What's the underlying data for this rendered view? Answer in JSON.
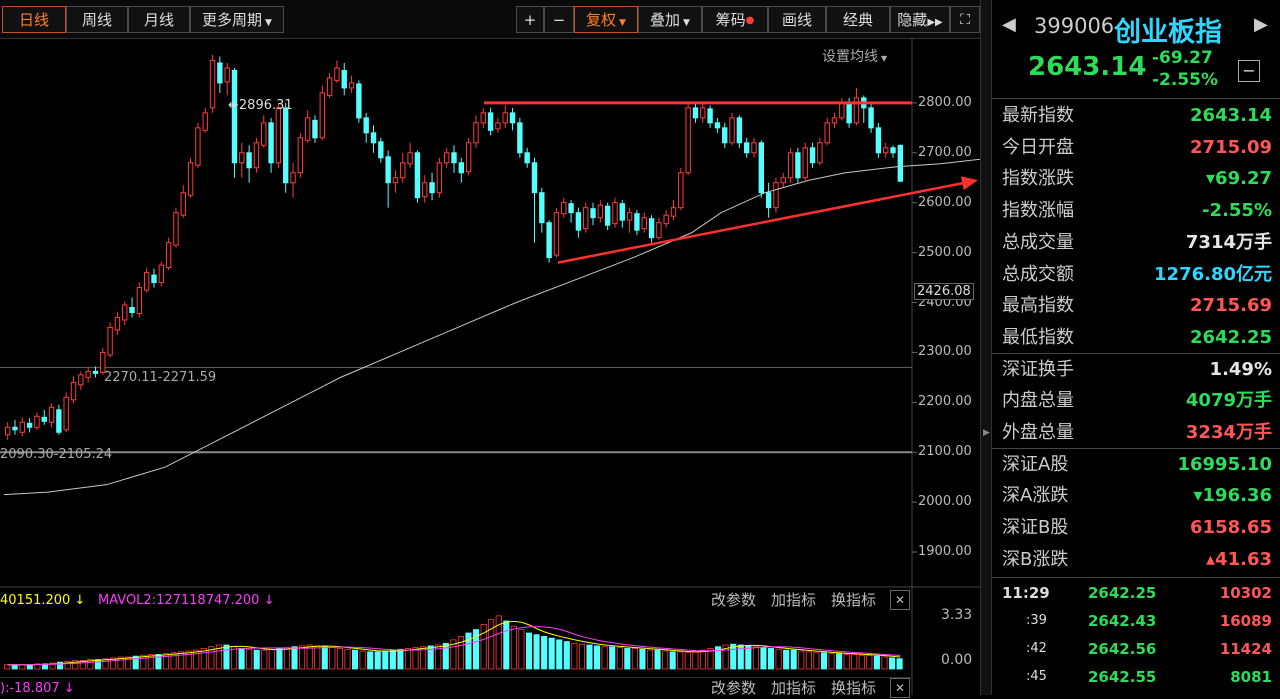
{
  "toolbar": {
    "periods": [
      "日线",
      "周线",
      "月线",
      "更多周期"
    ],
    "plus": "+",
    "minus": "−",
    "fuquan": "复权",
    "diejia": "叠加",
    "chouma": "筹码",
    "huaxian": "画线",
    "jingdian": "经典",
    "yincang": "隐藏",
    "set_ma": "设置均线"
  },
  "price_axis": {
    "labels": [
      "2800.00",
      "2700.00",
      "2600.00",
      "2500.00",
      "2400.00",
      "2300.00",
      "2200.00",
      "2100.00",
      "2000.00",
      "1900.00"
    ],
    "current": "2426.08"
  },
  "annotations": {
    "high": "2896.31",
    "mid": "2270.11-2271.59",
    "low": "2090.30-2105.24"
  },
  "volume_panel": {
    "legend1": "40151.200 ↓",
    "legend2": "MAVOL2:127118747.200 ↓",
    "btn_params": "改参数",
    "btn_add": "加指标",
    "btn_switch": "换指标",
    "close": "✕",
    "axis_top": "3.33",
    "axis_bottom": "0.00"
  },
  "macd_panel": {
    "legend": "):-18.807 ↓",
    "btn_params": "改参数",
    "btn_add": "加指标",
    "btn_switch": "换指标",
    "close": "✕"
  },
  "quote": {
    "code": "399006",
    "name": "创业板指",
    "price": "2643.14",
    "change": "-69.27",
    "change_pct": "-2.55%"
  },
  "stats": [
    {
      "label": "最新指数",
      "value": "2643.14",
      "color": "#2edc5a"
    },
    {
      "label": "今日开盘",
      "value": "2715.09",
      "color": "#ff5757"
    },
    {
      "label": "指数涨跌",
      "value": "▾69.27",
      "color": "#2edc5a"
    },
    {
      "label": "指数涨幅",
      "value": "-2.55%",
      "color": "#2edc5a"
    },
    {
      "label": "总成交量",
      "value": "7314万手",
      "color": "#e6e6e6"
    },
    {
      "label": "总成交额",
      "value": "1276.80亿元",
      "color": "#2fd7ff"
    },
    {
      "label": "最高指数",
      "value": "2715.69",
      "color": "#ff5757"
    },
    {
      "label": "最低指数",
      "value": "2642.25",
      "color": "#2edc5a"
    },
    {
      "label": "深证换手",
      "value": "1.49%",
      "color": "#e6e6e6"
    },
    {
      "label": "内盘总量",
      "value": "4079万手",
      "color": "#2edc5a"
    },
    {
      "label": "外盘总量",
      "value": "3234万手",
      "color": "#ff5757"
    },
    {
      "label": "深证A股",
      "value": "16995.10",
      "color": "#2edc5a"
    },
    {
      "label": "深A涨跌",
      "value": "▾196.36",
      "color": "#2edc5a"
    },
    {
      "label": "深证B股",
      "value": "6158.65",
      "color": "#ff5757"
    },
    {
      "label": "深B涨跌",
      "value": "▴41.63",
      "color": "#ff5757"
    }
  ],
  "ticks": [
    {
      "time": "11:29",
      "price": "2642.25",
      "vol": "10302"
    },
    {
      "time": ":39",
      "price": "2642.43",
      "vol": "16089"
    },
    {
      "time": ":42",
      "price": "2642.56",
      "vol": "11424"
    },
    {
      "time": ":45",
      "price": "2642.55",
      "vol": "8081"
    }
  ],
  "chart_data": {
    "type": "candlestick",
    "ylim": [
      1840,
      2930
    ],
    "price_ticks": [
      2800,
      2700,
      2600,
      2500,
      2400,
      2300,
      2200,
      2100,
      2000,
      1900
    ],
    "candles": [
      [
        2135,
        2150,
        2125,
        2160
      ],
      [
        2150,
        2145,
        2135,
        2165
      ],
      [
        2140,
        2160,
        2132,
        2170
      ],
      [
        2158,
        2150,
        2140,
        2168
      ],
      [
        2150,
        2172,
        2145,
        2180
      ],
      [
        2170,
        2162,
        2155,
        2185
      ],
      [
        2160,
        2190,
        2150,
        2198
      ],
      [
        2185,
        2140,
        2135,
        2195
      ],
      [
        2145,
        2210,
        2140,
        2220
      ],
      [
        2205,
        2240,
        2198,
        2252
      ],
      [
        2235,
        2255,
        2225,
        2262
      ],
      [
        2250,
        2262,
        2240,
        2270
      ],
      [
        2262,
        2258,
        2250,
        2272
      ],
      [
        2260,
        2300,
        2255,
        2310
      ],
      [
        2295,
        2350,
        2290,
        2360
      ],
      [
        2345,
        2370,
        2335,
        2380
      ],
      [
        2365,
        2395,
        2355,
        2402
      ],
      [
        2390,
        2380,
        2370,
        2410
      ],
      [
        2378,
        2430,
        2370,
        2440
      ],
      [
        2425,
        2460,
        2420,
        2470
      ],
      [
        2455,
        2440,
        2430,
        2468
      ],
      [
        2440,
        2475,
        2432,
        2482
      ],
      [
        2470,
        2520,
        2465,
        2530
      ],
      [
        2515,
        2580,
        2510,
        2590
      ],
      [
        2575,
        2620,
        2570,
        2635
      ],
      [
        2615,
        2680,
        2610,
        2690
      ],
      [
        2675,
        2750,
        2670,
        2760
      ],
      [
        2745,
        2780,
        2740,
        2790
      ],
      [
        2790,
        2885,
        2780,
        2896
      ],
      [
        2880,
        2840,
        2820,
        2893
      ],
      [
        2842,
        2870,
        2815,
        2880
      ],
      [
        2865,
        2680,
        2650,
        2870
      ],
      [
        2680,
        2700,
        2650,
        2720
      ],
      [
        2700,
        2670,
        2640,
        2715
      ],
      [
        2670,
        2720,
        2660,
        2730
      ],
      [
        2715,
        2760,
        2710,
        2775
      ],
      [
        2760,
        2680,
        2660,
        2770
      ],
      [
        2680,
        2790,
        2670,
        2800
      ],
      [
        2790,
        2640,
        2620,
        2800
      ],
      [
        2640,
        2660,
        2610,
        2680
      ],
      [
        2660,
        2730,
        2650,
        2740
      ],
      [
        2725,
        2770,
        2720,
        2785
      ],
      [
        2765,
        2730,
        2720,
        2775
      ],
      [
        2730,
        2820,
        2725,
        2835
      ],
      [
        2815,
        2850,
        2810,
        2860
      ],
      [
        2845,
        2870,
        2840,
        2885
      ],
      [
        2865,
        2830,
        2815,
        2880
      ],
      [
        2830,
        2840,
        2820,
        2855
      ],
      [
        2838,
        2770,
        2760,
        2845
      ],
      [
        2770,
        2740,
        2720,
        2780
      ],
      [
        2740,
        2720,
        2700,
        2755
      ],
      [
        2722,
        2690,
        2680,
        2730
      ],
      [
        2692,
        2640,
        2590,
        2705
      ],
      [
        2640,
        2650,
        2620,
        2665
      ],
      [
        2650,
        2680,
        2640,
        2700
      ],
      [
        2678,
        2700,
        2670,
        2720
      ],
      [
        2700,
        2610,
        2600,
        2705
      ],
      [
        2612,
        2640,
        2600,
        2655
      ],
      [
        2640,
        2620,
        2605,
        2660
      ],
      [
        2620,
        2680,
        2610,
        2690
      ],
      [
        2680,
        2700,
        2670,
        2710
      ],
      [
        2700,
        2680,
        2660,
        2715
      ],
      [
        2680,
        2660,
        2640,
        2690
      ],
      [
        2662,
        2720,
        2655,
        2730
      ],
      [
        2720,
        2760,
        2710,
        2775
      ],
      [
        2760,
        2780,
        2750,
        2790
      ],
      [
        2780,
        2745,
        2735,
        2790
      ],
      [
        2748,
        2760,
        2740,
        2770
      ],
      [
        2760,
        2780,
        2750,
        2795
      ],
      [
        2780,
        2760,
        2745,
        2790
      ],
      [
        2760,
        2700,
        2690,
        2770
      ],
      [
        2700,
        2680,
        2670,
        2710
      ],
      [
        2680,
        2620,
        2520,
        2690
      ],
      [
        2620,
        2560,
        2540,
        2630
      ],
      [
        2560,
        2490,
        2480,
        2565
      ],
      [
        2495,
        2580,
        2490,
        2590
      ],
      [
        2578,
        2600,
        2570,
        2610
      ],
      [
        2598,
        2580,
        2560,
        2605
      ],
      [
        2580,
        2545,
        2530,
        2590
      ],
      [
        2548,
        2590,
        2540,
        2600
      ],
      [
        2588,
        2570,
        2555,
        2600
      ],
      [
        2570,
        2595,
        2560,
        2605
      ],
      [
        2593,
        2555,
        2545,
        2600
      ],
      [
        2558,
        2600,
        2550,
        2610
      ],
      [
        2598,
        2565,
        2550,
        2605
      ],
      [
        2565,
        2580,
        2540,
        2590
      ],
      [
        2578,
        2545,
        2535,
        2585
      ],
      [
        2548,
        2570,
        2540,
        2580
      ],
      [
        2568,
        2530,
        2520,
        2575
      ],
      [
        2530,
        2560,
        2525,
        2570
      ],
      [
        2558,
        2575,
        2550,
        2585
      ],
      [
        2573,
        2590,
        2565,
        2605
      ],
      [
        2590,
        2660,
        2585,
        2670
      ],
      [
        2660,
        2790,
        2655,
        2800
      ],
      [
        2790,
        2770,
        2760,
        2800
      ],
      [
        2770,
        2790,
        2760,
        2800
      ],
      [
        2788,
        2760,
        2750,
        2795
      ],
      [
        2760,
        2750,
        2740,
        2770
      ],
      [
        2750,
        2720,
        2710,
        2760
      ],
      [
        2720,
        2770,
        2715,
        2780
      ],
      [
        2770,
        2720,
        2710,
        2775
      ],
      [
        2720,
        2700,
        2690,
        2730
      ],
      [
        2700,
        2720,
        2690,
        2730
      ],
      [
        2720,
        2620,
        2610,
        2725
      ],
      [
        2620,
        2590,
        2570,
        2640
      ],
      [
        2590,
        2640,
        2580,
        2650
      ],
      [
        2640,
        2650,
        2630,
        2660
      ],
      [
        2650,
        2700,
        2640,
        2710
      ],
      [
        2700,
        2650,
        2640,
        2710
      ],
      [
        2650,
        2710,
        2645,
        2720
      ],
      [
        2710,
        2680,
        2670,
        2720
      ],
      [
        2680,
        2720,
        2675,
        2730
      ],
      [
        2720,
        2760,
        2715,
        2770
      ],
      [
        2760,
        2770,
        2750,
        2780
      ],
      [
        2770,
        2800,
        2765,
        2810
      ],
      [
        2800,
        2760,
        2750,
        2810
      ],
      [
        2760,
        2810,
        2755,
        2830
      ],
      [
        2810,
        2790,
        2760,
        2815
      ],
      [
        2790,
        2750,
        2740,
        2800
      ],
      [
        2750,
        2700,
        2690,
        2760
      ],
      [
        2700,
        2710,
        2690,
        2720
      ],
      [
        2710,
        2700,
        2690,
        2715
      ],
      [
        2715,
        2643,
        2642,
        2716
      ]
    ],
    "ma": [
      [
        0,
        2015
      ],
      [
        6,
        2020
      ],
      [
        14,
        2035
      ],
      [
        22,
        2070
      ],
      [
        30,
        2130
      ],
      [
        38,
        2190
      ],
      [
        46,
        2250
      ],
      [
        54,
        2300
      ],
      [
        62,
        2350
      ],
      [
        70,
        2400
      ],
      [
        78,
        2445
      ],
      [
        86,
        2490
      ],
      [
        94,
        2540
      ],
      [
        98,
        2580
      ],
      [
        104,
        2620
      ],
      [
        110,
        2645
      ],
      [
        115,
        2660
      ],
      [
        122,
        2672
      ],
      [
        128,
        2678
      ],
      [
        134,
        2688
      ],
      [
        140,
        2685
      ],
      [
        148,
        2672
      ],
      [
        156,
        2668
      ],
      [
        160,
        2665
      ],
      [
        164,
        2660
      ],
      [
        167,
        2658
      ]
    ],
    "resistance": 2800,
    "support_line": [
      [
        2555,
        2480
      ],
      [
        975,
        2640
      ]
    ],
    "hlines": [
      2270,
      2100
    ],
    "volume": [
      5,
      5,
      5,
      5,
      6,
      6,
      7,
      8,
      9,
      10,
      10,
      11,
      11,
      12,
      13,
      14,
      14,
      15,
      16,
      17,
      17,
      18,
      19,
      20,
      21,
      22,
      24,
      26,
      28,
      28,
      26,
      24,
      23,
      22,
      22,
      23,
      24,
      25,
      26,
      27,
      28,
      27,
      26,
      25,
      24,
      23,
      22,
      21,
      20,
      20,
      21,
      22,
      23,
      24,
      25,
      26,
      27,
      28,
      30,
      34,
      38,
      42,
      46,
      52,
      58,
      62,
      56,
      50,
      46,
      42,
      40,
      38,
      36,
      34,
      32,
      30,
      29,
      28,
      27,
      26,
      26,
      25,
      24,
      24,
      23,
      22,
      22,
      21,
      20,
      20,
      19,
      20,
      22,
      24,
      26,
      28,
      29,
      28,
      27,
      26,
      25,
      24,
      23,
      22,
      22,
      21,
      20,
      19,
      19,
      18,
      18,
      17,
      17,
      16,
      16,
      15,
      14,
      13,
      12
    ]
  }
}
